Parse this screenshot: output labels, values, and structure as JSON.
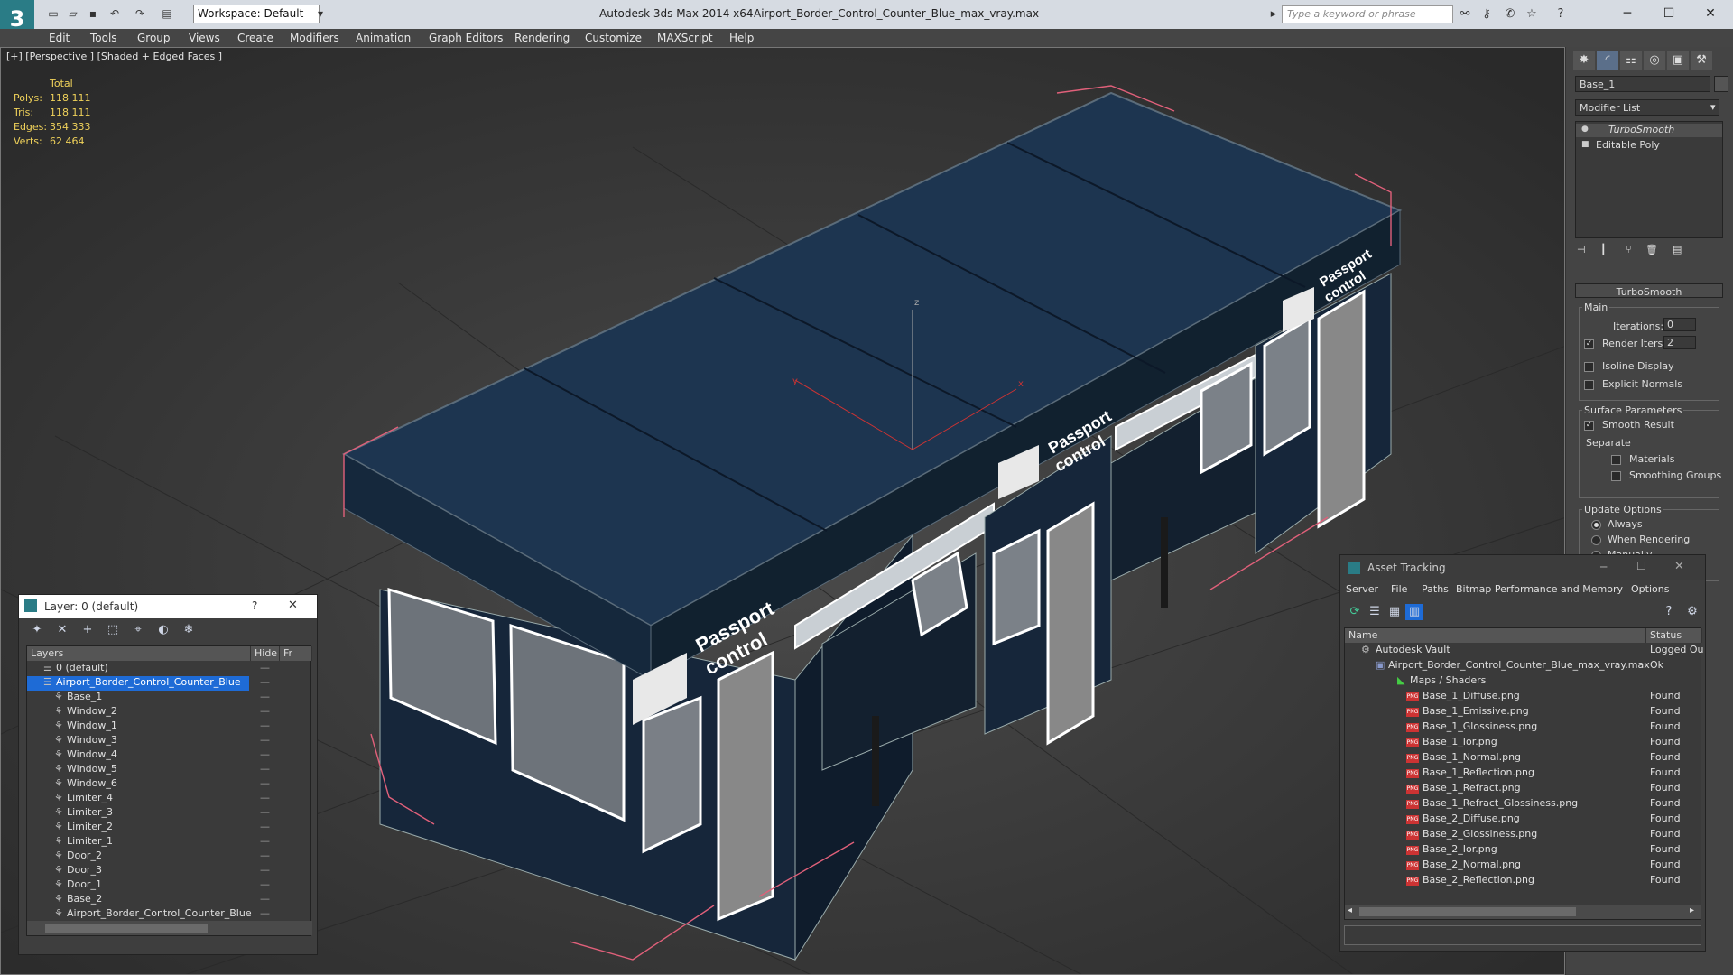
{
  "app": {
    "title": "Autodesk 3ds Max  2014 x64",
    "file": "Airport_Border_Control_Counter_Blue_max_vray.max",
    "logo": "3",
    "workspace": "Workspace: Default",
    "search_placeholder": "Type a keyword or phrase"
  },
  "menu": [
    "Edit",
    "Tools",
    "Group",
    "Views",
    "Create",
    "Modifiers",
    "Animation",
    "Graph Editors",
    "Rendering",
    "Customize",
    "MAXScript",
    "Help"
  ],
  "viewport": {
    "label": "[+] [Perspective ] [Shaded + Edged Faces ]",
    "stats": {
      "header": "Total",
      "rows": [
        {
          "label": "Polys:",
          "value": "118 111"
        },
        {
          "label": "Tris:",
          "value": "118 111"
        },
        {
          "label": "Edges:",
          "value": "354 333"
        },
        {
          "label": "Verts:",
          "value": "62 464"
        }
      ]
    },
    "sign_text_1": "Passport",
    "sign_text_2": "control",
    "axis_y": "y",
    "axis_x": "x",
    "axis_z": "z"
  },
  "command_panel": {
    "object_name": "Base_1",
    "modifier_list": "Modifier List",
    "stack": [
      "TurboSmooth",
      "Editable Poly"
    ],
    "rollout_title": "TurboSmooth",
    "main_label": "Main",
    "iterations_label": "Iterations:",
    "iterations_value": "0",
    "render_iters_label": "Render Iters:",
    "render_iters_value": "2",
    "isoline": "Isoline Display",
    "explicit_normals": "Explicit Normals",
    "surface_params": "Surface Parameters",
    "smooth_result": "Smooth Result",
    "separate": "Separate",
    "materials": "Materials",
    "smoothing_groups": "Smoothing Groups",
    "update_options": "Update Options",
    "always": "Always",
    "when_rendering": "When Rendering",
    "manually": "Manually"
  },
  "layer_panel": {
    "title": "Layer: 0 (default)",
    "help": "?",
    "close": "✕",
    "col_layers": "Layers",
    "col_hide": "Hide",
    "col_f": "Fr",
    "items": [
      {
        "name": "0 (default)",
        "level": 0
      },
      {
        "name": "Airport_Border_Control_Counter_Blue",
        "level": 0
      },
      {
        "name": "Base_1",
        "level": 1
      },
      {
        "name": "Window_2",
        "level": 1
      },
      {
        "name": "Window_1",
        "level": 1
      },
      {
        "name": "Window_3",
        "level": 1
      },
      {
        "name": "Window_4",
        "level": 1
      },
      {
        "name": "Window_5",
        "level": 1
      },
      {
        "name": "Window_6",
        "level": 1
      },
      {
        "name": "Limiter_4",
        "level": 1
      },
      {
        "name": "Limiter_3",
        "level": 1
      },
      {
        "name": "Limiter_2",
        "level": 1
      },
      {
        "name": "Limiter_1",
        "level": 1
      },
      {
        "name": "Door_2",
        "level": 1
      },
      {
        "name": "Door_3",
        "level": 1
      },
      {
        "name": "Door_1",
        "level": 1
      },
      {
        "name": "Base_2",
        "level": 1
      },
      {
        "name": "Airport_Border_Control_Counter_Blue",
        "level": 1
      }
    ]
  },
  "asset_panel": {
    "title": "Asset Tracking",
    "menu": [
      "Server",
      "File",
      "Paths",
      "Bitmap Performance and Memory",
      "Options"
    ],
    "col_name": "Name",
    "col_status": "Status",
    "vault": {
      "name": "Autodesk Vault",
      "status": "Logged Ou"
    },
    "file": {
      "name": "Airport_Border_Control_Counter_Blue_max_vray.max",
      "status": "Ok"
    },
    "maps": "Maps / Shaders",
    "files": [
      {
        "name": "Base_1_Diffuse.png",
        "status": "Found"
      },
      {
        "name": "Base_1_Emissive.png",
        "status": "Found"
      },
      {
        "name": "Base_1_Glossiness.png",
        "status": "Found"
      },
      {
        "name": "Base_1_Ior.png",
        "status": "Found"
      },
      {
        "name": "Base_1_Normal.png",
        "status": "Found"
      },
      {
        "name": "Base_1_Reflection.png",
        "status": "Found"
      },
      {
        "name": "Base_1_Refract.png",
        "status": "Found"
      },
      {
        "name": "Base_1_Refract_Glossiness.png",
        "status": "Found"
      },
      {
        "name": "Base_2_Diffuse.png",
        "status": "Found"
      },
      {
        "name": "Base_2_Glossiness.png",
        "status": "Found"
      },
      {
        "name": "Base_2_Ior.png",
        "status": "Found"
      },
      {
        "name": "Base_2_Normal.png",
        "status": "Found"
      },
      {
        "name": "Base_2_Reflection.png",
        "status": "Found"
      }
    ]
  },
  "colors": {
    "accent": "#1e6bd6",
    "stats": "#f0d25a",
    "roof": "#1d3550",
    "selection": "#e0607a"
  }
}
